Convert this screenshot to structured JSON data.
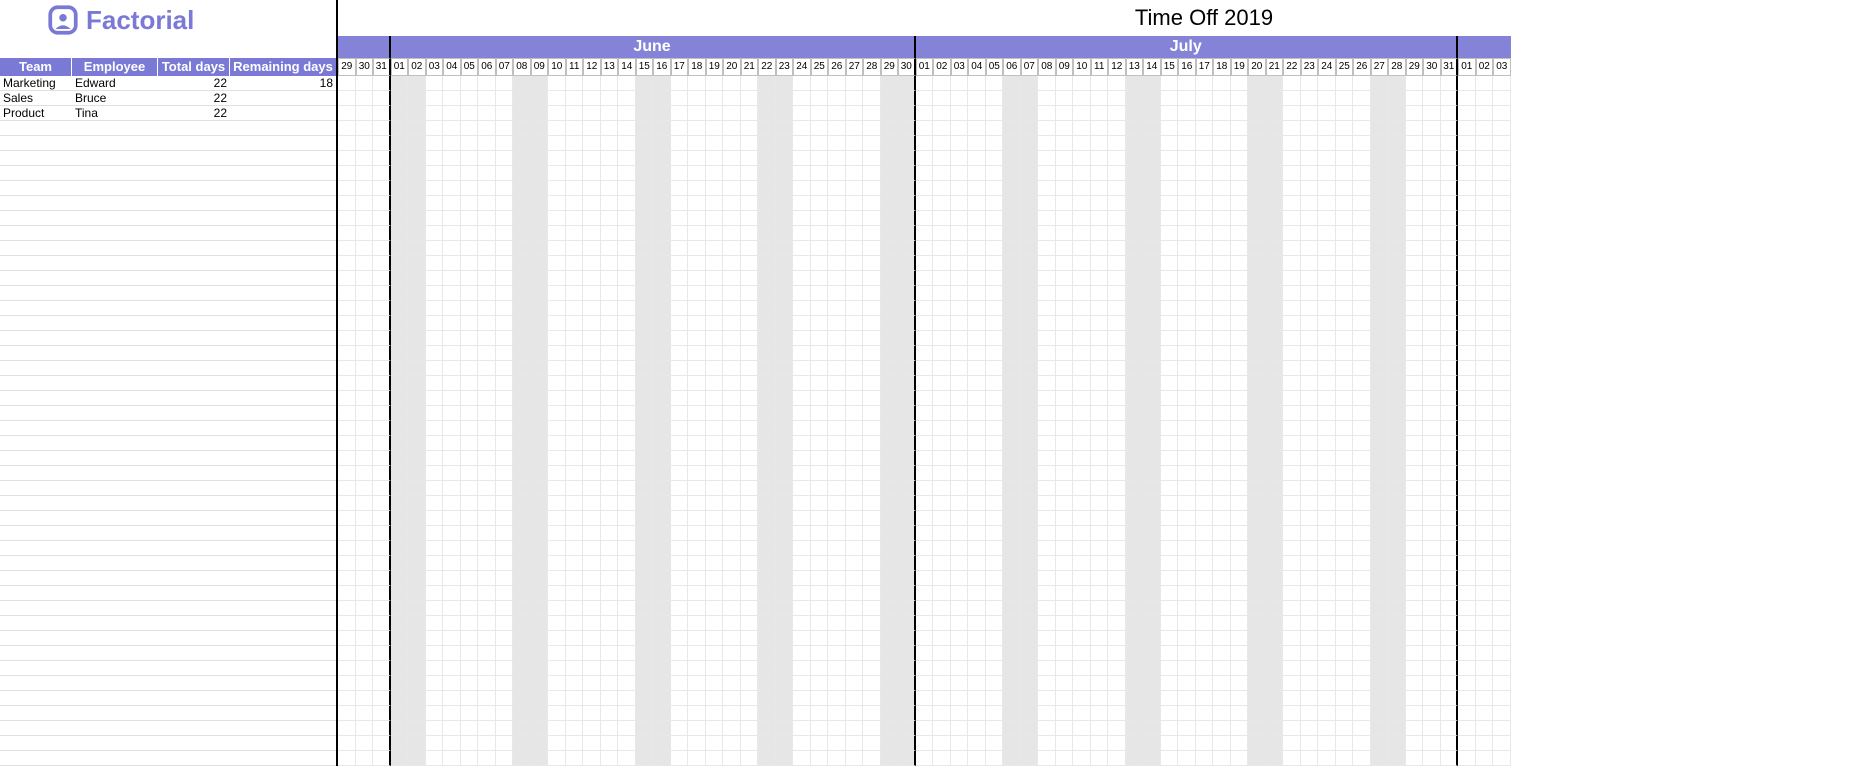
{
  "title": "Time Off 2019",
  "brand": "Factorial",
  "columns": {
    "team": "Team",
    "employee": "Employee",
    "total_days": "Total days",
    "remaining_days": "Remaining days"
  },
  "employees": [
    {
      "team": "Marketing",
      "name": "Edward",
      "total_days": "22",
      "remaining_days": "18"
    },
    {
      "team": "Sales",
      "name": "Bruce",
      "total_days": "22",
      "remaining_days": ""
    },
    {
      "team": "Product",
      "name": "Tina",
      "total_days": "22",
      "remaining_days": ""
    }
  ],
  "empty_rows": 43,
  "calendar": {
    "lead_in_days": [
      "29",
      "30",
      "31"
    ],
    "months": [
      {
        "name": "June",
        "days": 30,
        "weekends": [
          1,
          2,
          8,
          9,
          15,
          16,
          22,
          23,
          29,
          30
        ]
      },
      {
        "name": "July",
        "days": 31,
        "weekends": [
          6,
          7,
          13,
          14,
          20,
          21,
          27,
          28
        ]
      }
    ],
    "trail_days": [
      "01",
      "02",
      "03"
    ]
  }
}
